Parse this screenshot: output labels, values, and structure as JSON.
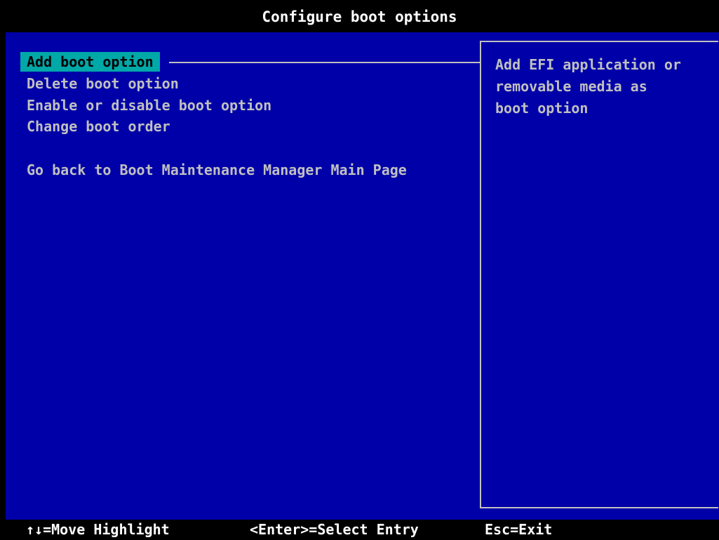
{
  "title": "Configure boot options",
  "menu": {
    "items": [
      {
        "label": "Add boot option",
        "selected": true
      },
      {
        "label": "Delete boot option",
        "selected": false
      },
      {
        "label": "Enable or disable boot option",
        "selected": false
      },
      {
        "label": "Change boot order",
        "selected": false
      },
      {
        "label": "Go back to Boot Maintenance Manager Main Page",
        "selected": false
      }
    ]
  },
  "help": {
    "text": "Add EFI application or\nremovable media as\nboot option"
  },
  "footer": {
    "move": "↑↓=Move Highlight",
    "select": "<Enter>=Select Entry",
    "exit": "Esc=Exit"
  },
  "colors": {
    "background": "#0000A8",
    "highlight": "#00A8A8",
    "text": "#C0C0C0",
    "bar": "#000000"
  }
}
